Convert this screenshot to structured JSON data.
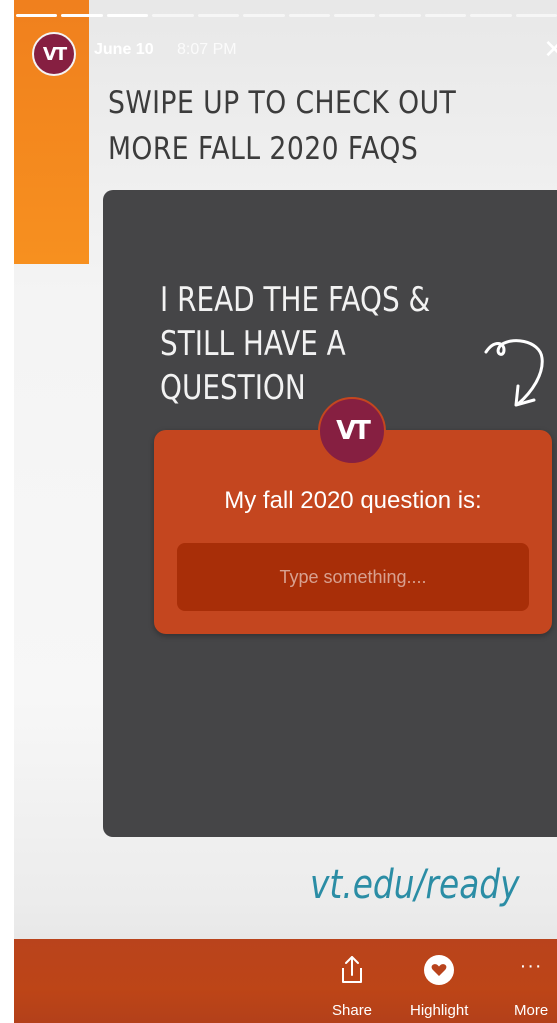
{
  "story": {
    "date": "June 10",
    "time": "8:07 PM",
    "avatar_text": "VT",
    "close_icon": "close-icon",
    "segments": 12
  },
  "content": {
    "headline_line1": "SWIPE UP TO CHECK OUT",
    "headline_line2": "MORE FALL 2020 FAQS",
    "card_title_line1": "I READ THE FAQS &",
    "card_title_line2": "STILL HAVE A QUESTION",
    "question_label": "My fall 2020 question is:",
    "question_placeholder": "Type something....",
    "url": "vt.edu/ready"
  },
  "actions": {
    "share": "Share",
    "highlight": "Highlight",
    "more": "More"
  },
  "colors": {
    "vt_maroon": "#861f41",
    "vt_orange": "#f7901f",
    "card_dark": "#454547",
    "question_card": "#c4461f",
    "url_teal": "#2b8da5",
    "bar_orange": "#bd4517"
  }
}
